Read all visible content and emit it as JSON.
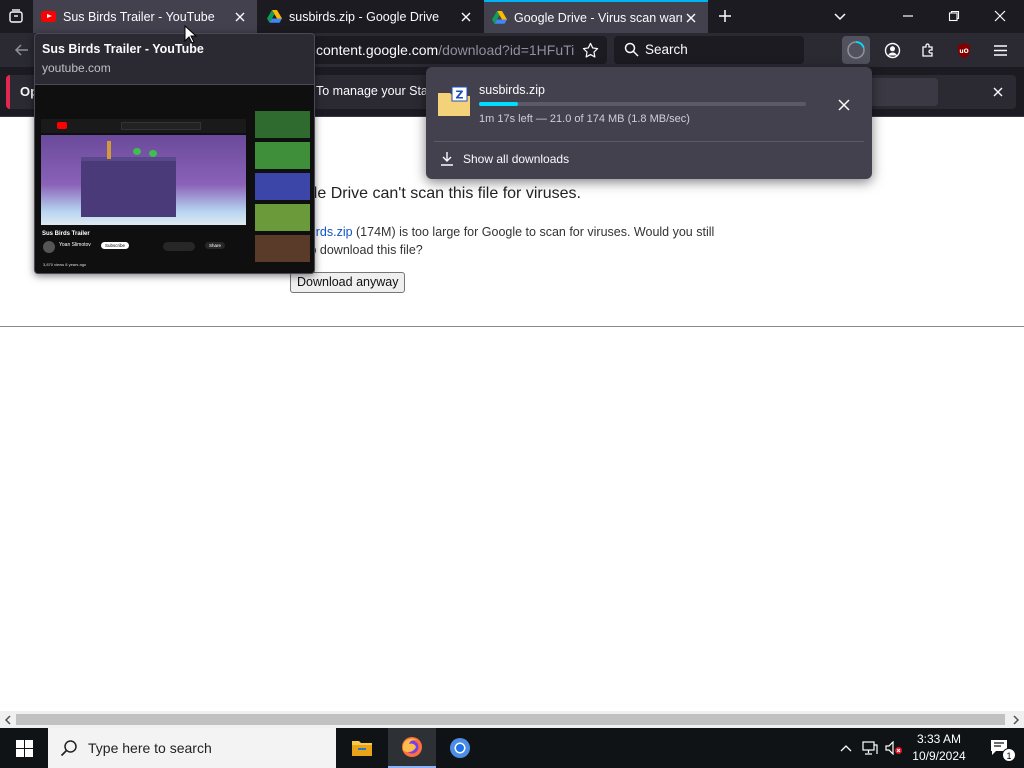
{
  "tabs": [
    {
      "title": "Sus Birds Trailer - YouTube",
      "favicon": "youtube-icon"
    },
    {
      "title": "susbirds.zip - Google Drive",
      "favicon": "google-drive-icon"
    },
    {
      "title": "Google Drive - Virus scan warning",
      "favicon": "google-drive-icon"
    }
  ],
  "navbar": {
    "url_prefix": "content.google.com",
    "url_path": "/download?id=1HFuTi",
    "search_placeholder": "Search"
  },
  "notification": {
    "left_text": "Op",
    "message": "To manage your Start"
  },
  "page": {
    "heading": "ogle Drive can't scan this file for viruses.",
    "link": "birds.zip",
    "body_rest": " (174M) is too large for Google to scan for viruses. Would you still",
    "body_line2": "to download this file?",
    "download_button": "Download anyway"
  },
  "tab_preview": {
    "title": "Sus Birds Trailer - YouTube",
    "url": "youtube.com",
    "video_title": "Sus Birds Trailer",
    "channel": "Yoan Slimotov",
    "subscribe": "Subscribe",
    "share": "Share",
    "views": "3,870 views  8 years ago"
  },
  "downloads_panel": {
    "file_name": "susbirds.zip",
    "status": "1m 17s left — 21.0 of 174 MB (1.8 MB/sec)",
    "progress_fraction": 0.12,
    "show_all": "Show all downloads"
  },
  "taskbar": {
    "search_placeholder": "Type here to search",
    "time": "3:33 AM",
    "date": "10/9/2024",
    "notification_count": "1"
  },
  "colors": {
    "accent": "#00b3f4",
    "progress": "#00ddff",
    "tab_strip": "#1c1b22",
    "toolbar": "#2b2a33"
  }
}
